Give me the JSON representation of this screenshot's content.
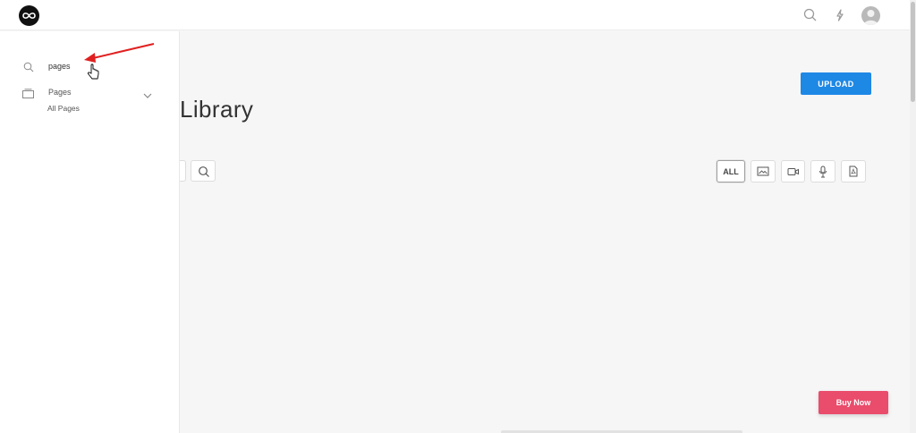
{
  "header": {
    "icons": [
      "logo-icon",
      "search-icon",
      "bolt-icon",
      "avatar"
    ]
  },
  "main": {
    "title": "Library",
    "upload_label": "UPLOAD",
    "filters": {
      "all_label": "ALL",
      "icons": [
        "image-icon",
        "video-icon",
        "microphone-icon",
        "pdf-icon"
      ]
    },
    "buy_now_label": "Buy Now"
  },
  "sidebar": {
    "search_value": "pages",
    "menu": {
      "label": "Pages",
      "sub_items": [
        "All Pages"
      ]
    }
  },
  "colors": {
    "accent_blue": "#1e88e5",
    "buy_pink": "#ea4c6c",
    "annotation_red": "#e02020"
  }
}
